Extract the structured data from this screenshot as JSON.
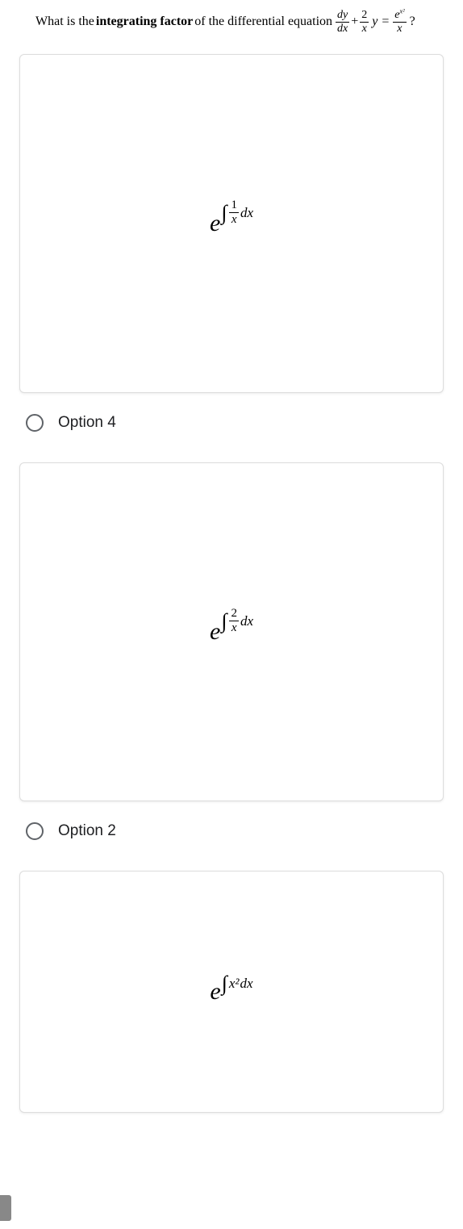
{
  "question": {
    "prefix": "What is the ",
    "bold": "integrating factor",
    "mid": " of the differential equation ",
    "eq": {
      "frac1_num": "dy",
      "frac1_den": "dx",
      "plus": "+",
      "frac2_num": "2",
      "frac2_den": "x",
      "y_eq": "y =",
      "frac3_num_base": "e",
      "frac3_num_sup": "x²",
      "frac3_den": "x",
      "suffix": "?"
    }
  },
  "options": [
    {
      "formula": {
        "int": "∫",
        "num": "1",
        "den": "x",
        "dx": "dx",
        "type": "frac"
      },
      "label": "Option 4"
    },
    {
      "formula": {
        "int": "∫",
        "num": "2",
        "den": "x",
        "dx": "dx",
        "type": "frac"
      },
      "label": "Option 2"
    },
    {
      "formula": {
        "int": "∫",
        "term": "x²",
        "dx": "dx",
        "type": "poly"
      },
      "label": ""
    }
  ]
}
